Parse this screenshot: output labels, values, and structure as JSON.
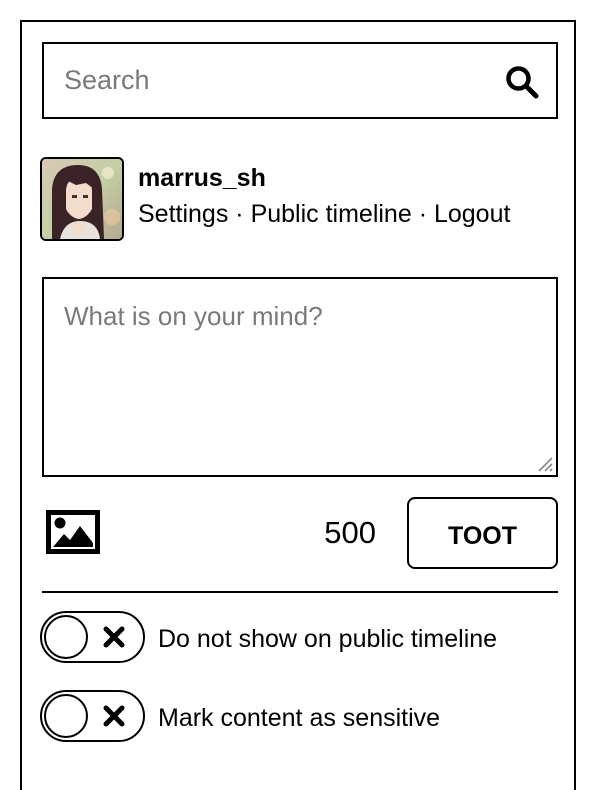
{
  "search": {
    "placeholder": "Search",
    "icon": "search-icon"
  },
  "account": {
    "username": "marrus_sh",
    "links": [
      "Settings",
      "Public timeline",
      "Logout"
    ],
    "separator": " · "
  },
  "compose": {
    "placeholder": "What is on your mind?",
    "char_count": "500",
    "submit_label": "TOOT",
    "media_icon": "image-icon"
  },
  "options": [
    {
      "label": "Do not show on public timeline",
      "enabled": false
    },
    {
      "label": "Mark content as sensitive",
      "enabled": false
    }
  ]
}
